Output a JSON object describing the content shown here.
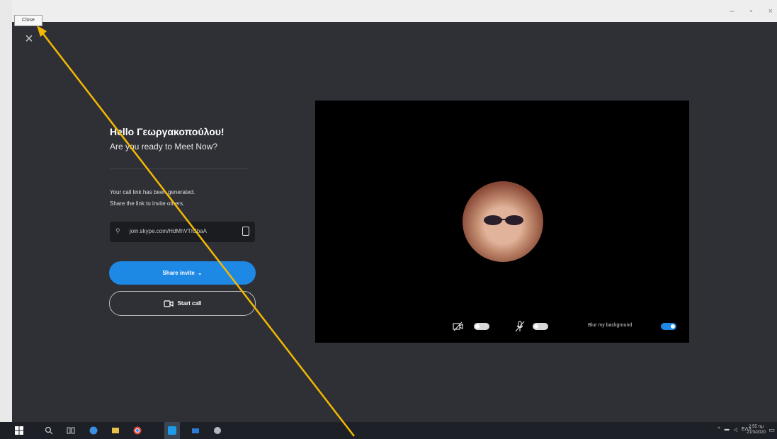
{
  "tooltip": "Close",
  "greeting": "Hello Γεωργακοπούλου!",
  "subtitle": "Are you ready to Meet Now?",
  "info_line1": "Your call link has been generated.",
  "info_line2": "Share the link to invite others.",
  "link_text": "join.skype.com/HdMhVTICbaA",
  "share_button": "Share invite",
  "start_button": "Start call",
  "blur_label": "Blur my background",
  "toggles": {
    "camera": "off",
    "microphone": "off",
    "blur": "on"
  },
  "tray": {
    "time": "2:55 πμ",
    "date": "21/3/2020",
    "lang": "ΕΛΛ"
  },
  "icons": [
    "close-icon",
    "link-icon",
    "copy-icon",
    "chevron-down-icon",
    "video-call-icon",
    "camera-off-icon",
    "mic-off-icon",
    "windows-start-icon",
    "search-icon",
    "task-view-icon",
    "edge-icon",
    "explorer-icon",
    "chrome-icon",
    "skype-icon",
    "mail-icon",
    "app-icon",
    "notifications-icon"
  ],
  "colors": {
    "accent": "#1e88e5",
    "panel": "#2f3036",
    "arrow": "#f5b800"
  }
}
